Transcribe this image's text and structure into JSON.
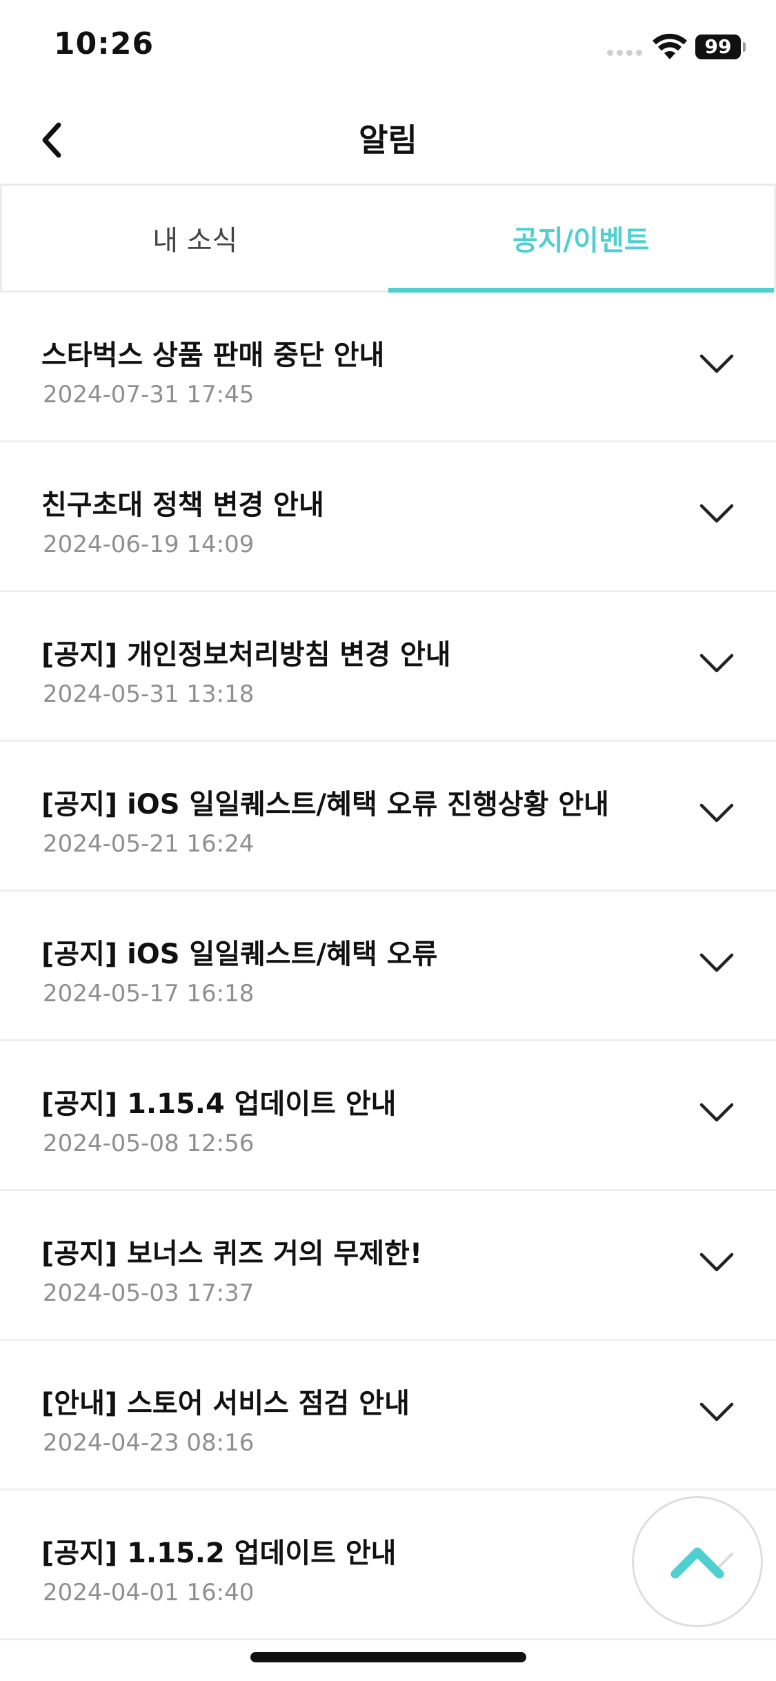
{
  "status_bar": {
    "time": "10:26",
    "battery": "99"
  },
  "header": {
    "title": "알림",
    "back_icon": "chevron-left-icon"
  },
  "tabs": [
    {
      "label": "내 소식",
      "active": false
    },
    {
      "label": "공지/이벤트",
      "active": true
    }
  ],
  "notices": [
    {
      "title": "스타벅스 상품 판매 중단 안내",
      "date": "2024-07-31 17:45"
    },
    {
      "title": "친구초대 정책 변경 안내",
      "date": "2024-06-19 14:09"
    },
    {
      "title": "[공지] 개인정보처리방침 변경 안내",
      "date": "2024-05-31 13:18"
    },
    {
      "title": "[공지] iOS 일일퀘스트/혜택 오류 진행상황 안내",
      "date": "2024-05-21 16:24"
    },
    {
      "title": "[공지] iOS 일일퀘스트/혜택 오류",
      "date": "2024-05-17 16:18"
    },
    {
      "title": "[공지] 1.15.4 업데이트 안내",
      "date": "2024-05-08 12:56"
    },
    {
      "title": "[공지] 보너스 퀴즈 거의 무제한!",
      "date": "2024-05-03 17:37"
    },
    {
      "title": "[안내] 스토어 서비스 점검 안내",
      "date": "2024-04-23 08:16"
    },
    {
      "title": "[공지] 1.15.2 업데이트 안내",
      "date": "2024-04-01 16:40"
    }
  ],
  "colors": {
    "accent": "#4fcfcf",
    "date_text": "#8f8f8f",
    "divider": "#efefef"
  }
}
